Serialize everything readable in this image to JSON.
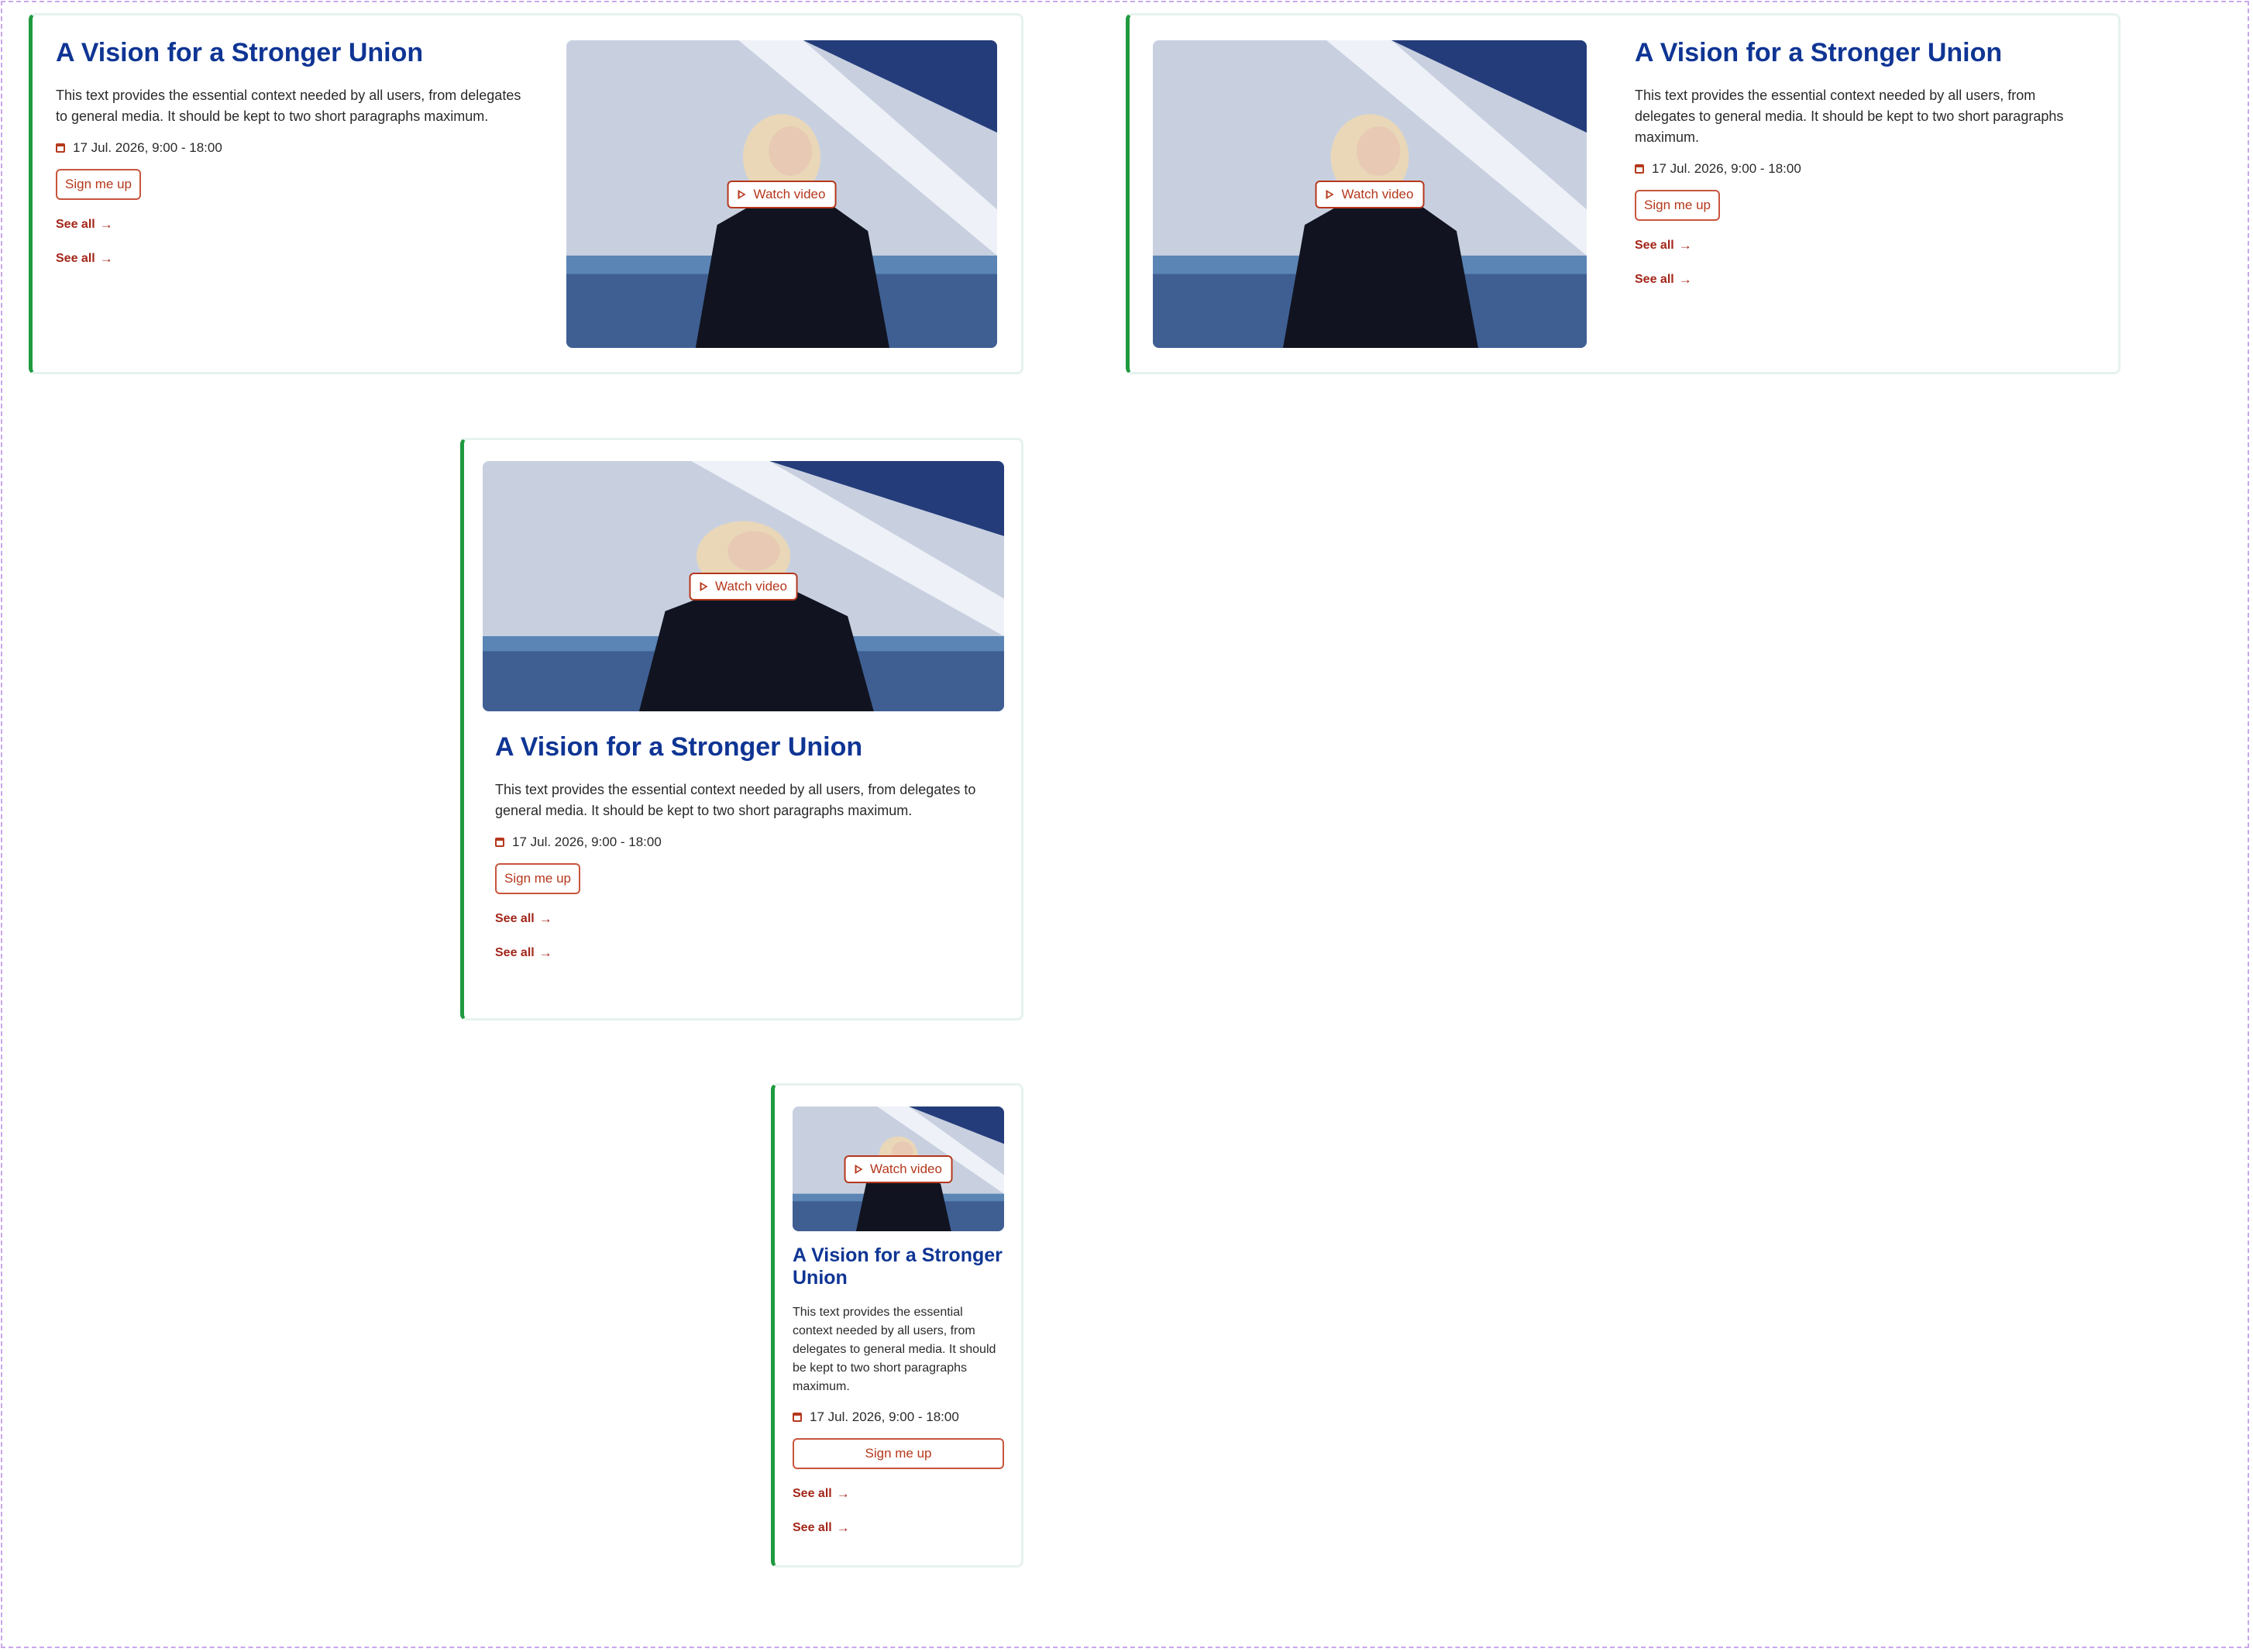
{
  "cards": [
    {
      "title": "A Vision for a Stronger Union",
      "description": "This text provides the essential context needed by all users, from delegates to general media. It should be kept to two short paragraphs maximum.",
      "date": "17 Jul. 2026, 9:00 - 18:00",
      "signup_label": "Sign me up",
      "watch_label": "Watch video",
      "links": [
        "See all",
        "See all"
      ]
    },
    {
      "title": "A Vision for a Stronger Union",
      "description": "This text provides the essential context needed by all users, from delegates to general media. It should be kept to two short paragraphs maximum.",
      "date": "17 Jul. 2026, 9:00 - 18:00",
      "signup_label": "Sign me up",
      "watch_label": "Watch video",
      "links": [
        "See all",
        "See all"
      ]
    },
    {
      "title": "A Vision for a Stronger Union",
      "description": "This text provides the essential context needed by all users, from delegates to general media. It should be kept to two short paragraphs maximum.",
      "date": "17 Jul. 2026, 9:00 - 18:00",
      "signup_label": "Sign me up",
      "watch_label": "Watch video",
      "links": [
        "See all",
        "See all"
      ]
    },
    {
      "title": "A Vision for a Stronger Union",
      "description": "This text provides the essential context needed by all users, from delegates to general media. It should be kept to two short paragraphs maximum.",
      "date": "17 Jul. 2026, 9:00 - 18:00",
      "signup_label": "Sign me up",
      "watch_label": "Watch video",
      "links": [
        "See all",
        "See all"
      ]
    }
  ],
  "icons": {
    "date": "calendar-icon",
    "watch": "play-icon",
    "link": "arrow-right-icon"
  },
  "colors": {
    "title": "#0f3594",
    "accent": "#b5381c",
    "card_border_left": "#1f9a3f"
  }
}
